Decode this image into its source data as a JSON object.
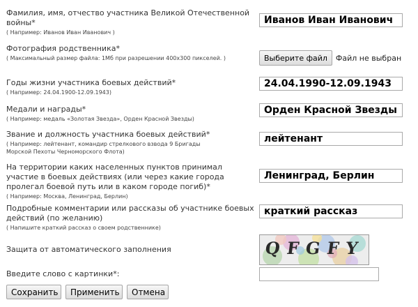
{
  "fields": {
    "name": {
      "label": "Фамилия, имя, отчество участника Великой Отечественной войны",
      "required_mark": "*",
      "hint": "( Например: Иванов Иван Иванович )",
      "value": "Иванов Иван Иванович"
    },
    "photo": {
      "label": "Фотография родственника",
      "required_mark": "*",
      "hint": "( Максимальный размер файла: 1Мб при разрешении 400x300 пикселей. )",
      "button_label": "Выберите файл",
      "status": "Файл не выбран"
    },
    "years": {
      "label": "Годы жизни участника боевых действий",
      "required_mark": "*",
      "hint": "( Например: 24.04.1900-12.09.1943)",
      "value": "24.04.1990-12.09.1943"
    },
    "medals": {
      "label": "Медали и награды",
      "required_mark": "*",
      "hint": "( Например: медаль «Золотая Звезда», Орден Красной Звезды)",
      "value": "Орден Красной Звезды"
    },
    "rank": {
      "label": "Звание и должность участника боевых действий",
      "required_mark": "*",
      "hint": "( Например: лейтенант, командир стрелкового взвода 9 Бригады\nМорской Пехоты Черноморского Флота)",
      "value": "лейтенант"
    },
    "places": {
      "label": "На территории каких населенных пунктов принимал участие в боевых действиях (или через какие города пролегал боевой путь или в каком городе погиб)",
      "required_mark": "*",
      "hint": "( Например: Москва, Ленинград, Берлин)",
      "value": "Ленинград, Берлин"
    },
    "comments": {
      "label": "Подробные комментарии или рассказы об участнике боевых действий (по желанию)",
      "hint": "( Напишите краткий рассказ о своем родственнике)",
      "value": "краткий рассказ"
    },
    "captcha": {
      "label": "Защита от автоматического заполнения",
      "text": "QFGFY"
    },
    "captcha_answer": {
      "label": "Введите слово с картинки",
      "required_mark": "*:",
      "value": ""
    }
  },
  "buttons": {
    "save": "Сохранить",
    "apply": "Применить",
    "cancel": "Отмена"
  },
  "colors": {
    "text": "#333333",
    "input_border": "#a9a9a9"
  }
}
